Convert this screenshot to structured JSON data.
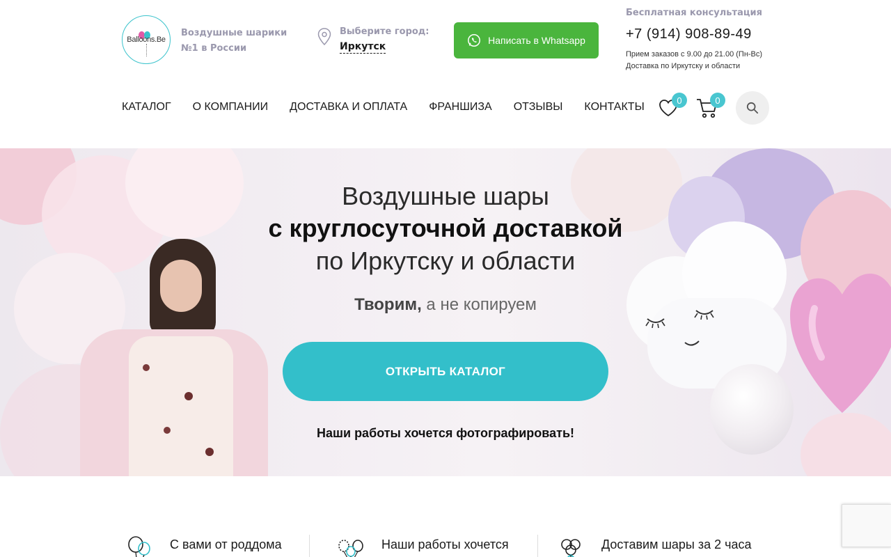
{
  "header": {
    "logo_text": "Balloons.Be",
    "tagline_line1": "Воздушные шарики",
    "tagline_line2": "№1 в России",
    "city_label": "Выберите город:",
    "city_name": "Иркутск",
    "whatsapp_label": "Написать в Whatsapp",
    "consult_title": "Бесплатная консультация",
    "phone": "+7 (914) 908-89-49",
    "hours": "Прием заказов с 9.00 до 21.00 (Пн-Вс)",
    "delivery_area": "Доставка по Иркутску и области"
  },
  "nav": {
    "items": [
      "КАТАЛОГ",
      "О КОМПАНИИ",
      "ДОСТАВКА И ОПЛАТА",
      "ФРАНШИЗА",
      "ОТЗЫВЫ",
      "КОНТАКТЫ"
    ],
    "favorites_count": "0",
    "cart_count": "0"
  },
  "hero": {
    "title_line1": "Воздушные шары",
    "title_line2": "с круглосуточной доставкой",
    "title_line3": "по Иркутску и области",
    "subtitle_bold": "Творим,",
    "subtitle_rest": " а не копируем",
    "cta_label": "ОТКРЫТЬ КАТАЛОГ",
    "note": "Наши работы хочется фотографировать!"
  },
  "features": [
    {
      "text": "С вами от роддома",
      "icon": "balloons-icon"
    },
    {
      "text": "Наши работы хочется",
      "icon": "balloon-bunch-icon"
    },
    {
      "text": "Доставим шары за 2 часа",
      "icon": "delivery-balloons-icon"
    }
  ],
  "colors": {
    "accent": "#33bfca",
    "whatsapp": "#4ab53d",
    "muted_text": "#9a98ad",
    "badge": "#49c6d0"
  }
}
